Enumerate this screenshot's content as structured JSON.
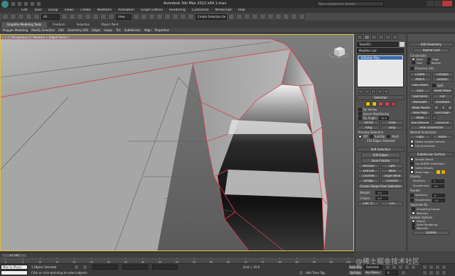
{
  "app": {
    "title": "Autodesk 3ds Max 2012 x64     1.max",
    "search_placeholder": "Type a keyword or phrase"
  },
  "toolbar": {
    "selection_filter": "All",
    "coord_system": "View",
    "named_set": "Create Selection Se"
  },
  "menu_items": [
    "Edit",
    "Tools",
    "Group",
    "Views",
    "Create",
    "Modifiers",
    "Animation",
    "Graph Editors",
    "Rendering",
    "Customize",
    "MAXScript",
    "Help"
  ],
  "ribbon": {
    "tabs": [
      "Graphite Modeling Tools",
      "Freeform",
      "Selection",
      "Object Paint"
    ],
    "subtabs": [
      "Polygon Modeling",
      "Modify Selection",
      "Edit",
      "Geometry (All)",
      "Edges",
      "Loops",
      "Tris",
      "Subdivision",
      "Align",
      "Properties"
    ]
  },
  "viewport": {
    "label": "[ + ] [ Perspective ] [ Realistic + Edged Faces ]"
  },
  "modify_panel": {
    "object_name": "Tube001",
    "modifier_list": "Modifier List",
    "stack_item": "Editable Poly",
    "selection": {
      "title": "Selection",
      "by_vertex": "By Vertex",
      "ignore_backfacing": "Ignore Backfacing",
      "by_angle": "By Angle:",
      "angle_value": "45.0",
      "shrink": "Shrink",
      "grow": "Grow",
      "ring": "Ring",
      "loop": "Loop",
      "preview_selection": "Preview Selection",
      "off": "Off",
      "subobj": "SubObj",
      "multi": "Multi",
      "status": "216 Edges Selected"
    },
    "soft_selection": {
      "title": "Soft Selection",
      "edit_edges": "Edit Edges",
      "insert_vertex": "Insert Vertex",
      "remove": "Remove",
      "split": "Split",
      "extrude": "Extrude",
      "weld": "Weld",
      "chamfer": "Chamfer",
      "target_weld": "Target Weld",
      "bridge": "Bridge",
      "connect": "Connect",
      "create_shape": "Create Shape From Selection",
      "weight_label": "Weight:",
      "weight_value": "1.0",
      "crease_label": "Crease:",
      "crease_value": "0.0",
      "edit_tri": "Edit Tri.",
      "turn": "Turn"
    }
  },
  "edit_geometry": {
    "title": "Edit Geometry",
    "repeat_last": "Repeat Last",
    "constraints": "Constraints",
    "none": "None",
    "edge": "Edge",
    "face": "Face",
    "normal": "Normal",
    "preserve_uvs": "Preserve UVs",
    "create": "Create",
    "collapse": "Collapse",
    "attach": "Attach",
    "detach": "Detach",
    "slice_plane": "Slice Plane",
    "split": "Split",
    "slice": "Slice",
    "reset_plane": "Reset Plane",
    "quickslice": "QuickSlice",
    "cut": "Cut",
    "msmooth": "MSmooth",
    "tessellate": "Tessellate",
    "make_planar": "Make Planar",
    "x": "X",
    "y": "Y",
    "z": "Z",
    "view_align": "View Align",
    "grid_align": "Grid Align",
    "relax": "Relax",
    "hide_selected": "Hide Selected",
    "unhide_all": "Unhide All",
    "hide_unselected": "Hide Unselected",
    "named_selections": "Named Selections:",
    "copy": "Copy",
    "paste": "Paste",
    "delete_isolated": "Delete Isolated Vertices",
    "full_interactivity": "Full Interactivity"
  },
  "subdivision": {
    "title": "Subdivision Surface",
    "smooth_result": "Smooth Result",
    "use_nurms": "Use NURMS Subdivision",
    "isoline_display": "Isoline Display",
    "show_cage": "Show Cage......",
    "display": "Display",
    "iterations_label": "Iterations:",
    "iterations_value": "1",
    "smoothness_label": "Smoothness:",
    "smoothness_value": "1.0",
    "render": "Render",
    "render_iter_value": "0",
    "render_smooth_value": "1.0",
    "separate_by": "Separate By",
    "smoothing_groups": "Smoothing Groups",
    "materials": "Materials",
    "update_options": "Update Options",
    "always": "Always",
    "when_rendering": "When Rendering",
    "manually": "Manually",
    "update": "Update"
  },
  "timeline": {
    "frame_counter": "0 / 100",
    "ticks": [
      "0",
      "5",
      "10",
      "15",
      "20",
      "25",
      "30",
      "35",
      "40",
      "45",
      "50",
      "55",
      "60",
      "65",
      "70",
      "75",
      "80",
      "85",
      "90",
      "95",
      "100"
    ]
  },
  "status": {
    "script_box": "Max to Physc.",
    "selected": "1 Object Selected",
    "prompt": "Click or click-and-drag to select objects",
    "grid": "Grid = 10.0",
    "add_time_tag": "Add Time Tag",
    "auto_key": "Auto Key",
    "selected_dropdown": "Selected",
    "set_key": "Set Key",
    "key_filters": "Key Filters...",
    "frame": "0"
  },
  "watermark": "@稀土掘金技术社区",
  "colors": {
    "accent": "#e8c000",
    "selection_edge": "#d84050",
    "stack_highlight": "#3a6ab0"
  }
}
